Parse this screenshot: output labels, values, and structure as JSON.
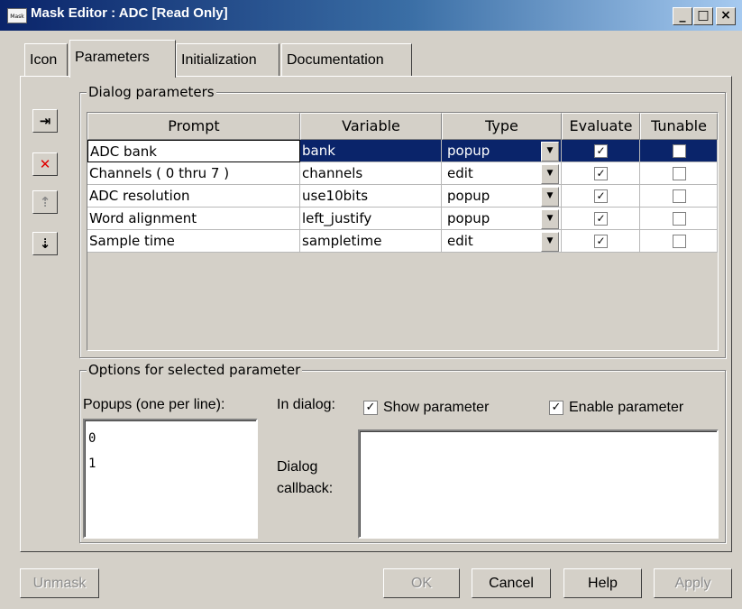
{
  "window": {
    "title": "Mask Editor : ADC [Read Only]",
    "app_icon_text": "Mask",
    "minimize_glyph": "_",
    "maximize_glyph": "□",
    "close_glyph": "×"
  },
  "tabs": [
    {
      "label": "Icon"
    },
    {
      "label": "Parameters"
    },
    {
      "label": "Initialization"
    },
    {
      "label": "Documentation"
    }
  ],
  "dialog_params": {
    "label": "Dialog parameters",
    "side_buttons": [
      {
        "icon": "add-parameter-icon",
        "glyph": "⇥"
      },
      {
        "icon": "delete-icon",
        "glyph": "✕"
      },
      {
        "icon": "move-up-icon",
        "glyph": "⇡"
      },
      {
        "icon": "move-down-icon",
        "glyph": "⇣"
      }
    ],
    "columns": [
      "Prompt",
      "Variable",
      "Type",
      "Evaluate",
      "Tunable"
    ],
    "rows": [
      {
        "prompt": "ADC bank",
        "variable": "bank",
        "type": "popup",
        "evaluate": true,
        "tunable": false,
        "selected": true
      },
      {
        "prompt": "Channels ( 0 thru 7 )",
        "variable": "channels",
        "type": "edit",
        "evaluate": true,
        "tunable": false,
        "selected": false
      },
      {
        "prompt": "ADC resolution",
        "variable": "use10bits",
        "type": "popup",
        "evaluate": true,
        "tunable": false,
        "selected": false
      },
      {
        "prompt": "Word alignment",
        "variable": "left_justify",
        "type": "popup",
        "evaluate": true,
        "tunable": false,
        "selected": false
      },
      {
        "prompt": "Sample time",
        "variable": "sampletime",
        "type": "edit",
        "evaluate": true,
        "tunable": false,
        "selected": false
      }
    ]
  },
  "options": {
    "label": "Options for selected parameter",
    "popups_label": "Popups (one per line):",
    "popups_value": "0\n1",
    "in_dialog_label": "In dialog:",
    "show_parameter_label": "Show parameter",
    "show_parameter_checked": true,
    "enable_parameter_label": "Enable parameter",
    "enable_parameter_checked": true,
    "dialog_callback_label_line1": "Dialog",
    "dialog_callback_label_line2": "callback:",
    "dialog_callback_value": ""
  },
  "buttons": {
    "unmask": "Unmask",
    "ok": "OK",
    "cancel": "Cancel",
    "help": "Help",
    "apply": "Apply"
  },
  "colors": {
    "title_bar": "#0a246a",
    "selection": "#0a246a",
    "face": "#d4d0c8"
  }
}
